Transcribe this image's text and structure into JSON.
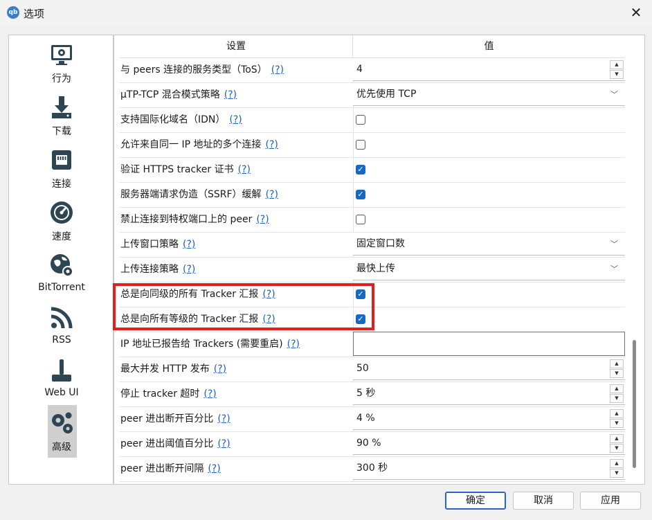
{
  "window": {
    "title": "选项",
    "app_icon_text": "qb"
  },
  "sidebar": {
    "items": [
      {
        "label": "行为",
        "icon": "monitor-gear-icon"
      },
      {
        "label": "下载",
        "icon": "download-icon"
      },
      {
        "label": "连接",
        "icon": "ethernet-icon"
      },
      {
        "label": "速度",
        "icon": "speedometer-icon"
      },
      {
        "label": "BitTorrent",
        "icon": "globe-gear-icon"
      },
      {
        "label": "RSS",
        "icon": "rss-icon"
      },
      {
        "label": "Web UI",
        "icon": "joystick-icon"
      },
      {
        "label": "高级",
        "icon": "gears-icon",
        "selected": true
      }
    ]
  },
  "table": {
    "headers": {
      "setting": "设置",
      "value": "值"
    },
    "help_text": "(?)",
    "rows": [
      {
        "label": "与 peers 连接的服务类型（ToS）",
        "type": "spin",
        "value": "4"
      },
      {
        "label": "μTP-TCP 混合模式策略",
        "type": "combo",
        "value": "优先使用 TCP"
      },
      {
        "label": "支持国际化域名（IDN）",
        "type": "check",
        "checked": false
      },
      {
        "label": "允许来自同一 IP 地址的多个连接",
        "type": "check",
        "checked": false
      },
      {
        "label": "验证 HTTPS tracker 证书",
        "type": "check",
        "checked": true
      },
      {
        "label": "服务器端请求伪造（SSRF）缓解",
        "type": "check",
        "checked": true
      },
      {
        "label": "禁止连接到特权端口上的 peer",
        "type": "check",
        "checked": false
      },
      {
        "label": "上传窗口策略",
        "type": "combo",
        "value": "固定窗口数"
      },
      {
        "label": "上传连接策略",
        "type": "combo",
        "value": "最快上传"
      },
      {
        "label": "总是向同级的所有 Tracker 汇报",
        "type": "check",
        "checked": true
      },
      {
        "label": "总是向所有等级的 Tracker 汇报",
        "type": "check",
        "checked": true
      },
      {
        "label": "IP 地址已报告给 Trackers (需要重启)",
        "type": "text",
        "value": ""
      },
      {
        "label": "最大并发 HTTP 发布",
        "type": "spin",
        "value": "50"
      },
      {
        "label": "停止 tracker 超时",
        "type": "spin",
        "value": "5 秒"
      },
      {
        "label": "peer 进出断开百分比",
        "type": "spin",
        "value": "4 %"
      },
      {
        "label": "peer 进出阈值百分比",
        "type": "spin",
        "value": "90 %"
      },
      {
        "label": "peer 进出断开间隔",
        "type": "spin",
        "value": "300 秒"
      }
    ]
  },
  "buttons": {
    "ok": "确定",
    "cancel": "取消",
    "apply": "应用"
  },
  "colors": {
    "accent": "#1668c7",
    "highlight": "#e02020",
    "link": "#1a5fc8"
  }
}
